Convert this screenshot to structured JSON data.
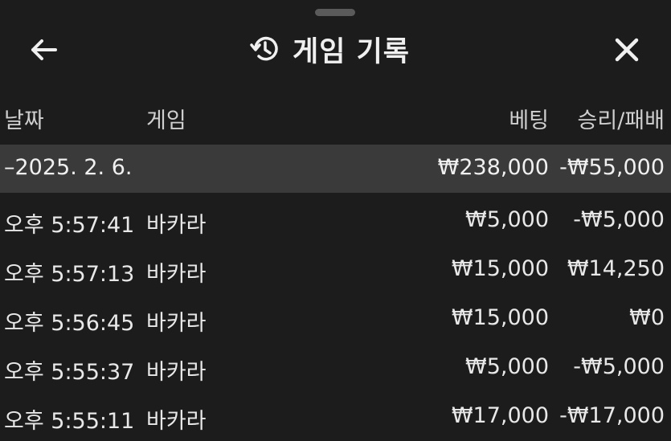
{
  "header": {
    "title": "게임 기록",
    "back_icon": "arrow-left-icon",
    "history_icon": "history-icon",
    "close_icon": "close-icon"
  },
  "columns": {
    "date": "날짜",
    "game": "게임",
    "bet": "베팅",
    "result": "승리/패배"
  },
  "summary": {
    "date": "–2025. 2. 6.",
    "bet": "₩238,000",
    "result": "-₩55,000"
  },
  "rows": [
    {
      "time": "오후 5:57:41",
      "game": "바카라",
      "bet": "₩5,000",
      "result": "-₩5,000"
    },
    {
      "time": "오후 5:57:13",
      "game": "바카라",
      "bet": "₩15,000",
      "result": "₩14,250"
    },
    {
      "time": "오후 5:56:45",
      "game": "바카라",
      "bet": "₩15,000",
      "result": "₩0"
    },
    {
      "time": "오후 5:55:37",
      "game": "바카라",
      "bet": "₩5,000",
      "result": "-₩5,000"
    },
    {
      "time": "오후 5:55:11",
      "game": "바카라",
      "bet": "₩17,000",
      "result": "-₩17,000"
    }
  ]
}
